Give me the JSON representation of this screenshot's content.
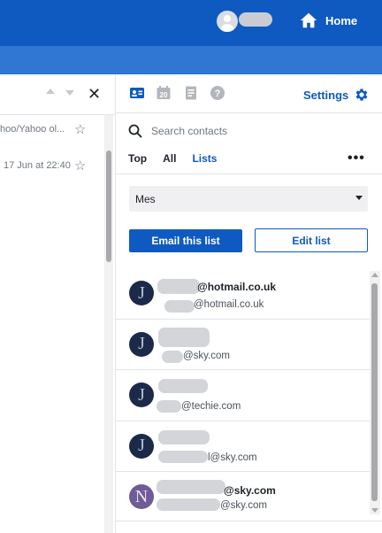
{
  "header": {
    "home_label": "Home",
    "brand_color": "#0f5ac0",
    "subbar_color": "#2f77d2"
  },
  "left_panel": {
    "emails": [
      {
        "snippet": "hoo/Yahoo ol..."
      },
      {
        "snippet": "17 Jun at 22:40"
      }
    ]
  },
  "contacts_panel": {
    "toolbar": {
      "settings_label": "Settings",
      "calendar_day": "20"
    },
    "search": {
      "placeholder": "Search contacts"
    },
    "tabs": [
      {
        "label": "Top",
        "active": false
      },
      {
        "label": "All",
        "active": false
      },
      {
        "label": "Lists",
        "active": true
      }
    ],
    "list_select": {
      "selected": "Mes"
    },
    "buttons": {
      "email_list": "Email this list",
      "edit_list": "Edit list"
    },
    "contacts": [
      {
        "initial": "J",
        "name": "@hotmail.co.uk",
        "email": "@hotmail.co.uk"
      },
      {
        "initial": "J",
        "name": "",
        "email": "@sky.com"
      },
      {
        "initial": "J",
        "name": "",
        "email": "@techie.com"
      },
      {
        "initial": "J",
        "name": "",
        "email": "l@sky.com"
      },
      {
        "initial": "N",
        "name": "@sky.com",
        "email": "@sky.com"
      }
    ]
  }
}
